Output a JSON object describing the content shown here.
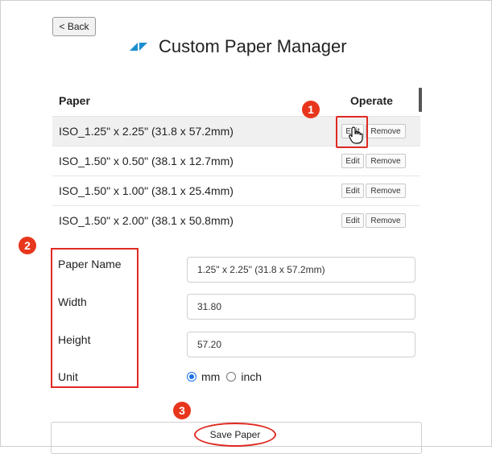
{
  "header": {
    "back_label": "< Back",
    "title": "Custom Paper Manager",
    "logo_icon": "zebra-logo-icon"
  },
  "table": {
    "columns": [
      "Paper",
      "Operate"
    ],
    "rows": [
      {
        "name": "ISO_1.25\" x 2.25\" (31.8 x 57.2mm)",
        "edit": "Edit",
        "remove": "Remove"
      },
      {
        "name": "ISO_1.50\" x 0.50\" (38.1 x 12.7mm)",
        "edit": "Edit",
        "remove": "Remove"
      },
      {
        "name": "ISO_1.50\" x 1.00\" (38.1 x 25.4mm)",
        "edit": "Edit",
        "remove": "Remove"
      },
      {
        "name": "ISO_1.50\" x 2.00\" (38.1 x 50.8mm)",
        "edit": "Edit",
        "remove": "Remove"
      }
    ]
  },
  "form": {
    "paper_name_label": "Paper Name",
    "paper_name_value": "1.25\" x 2.25\" (31.8 x 57.2mm)",
    "width_label": "Width",
    "width_value": "31.80",
    "height_label": "Height",
    "height_value": "57.20",
    "unit_label": "Unit",
    "unit_options": [
      "mm",
      "inch"
    ],
    "unit_selected": "mm"
  },
  "save_label": "Save Paper",
  "annotations": {
    "badge1": "1",
    "badge2": "2",
    "badge3": "3",
    "color": "#e8361c"
  },
  "colors": {
    "accent": "#1a73e8",
    "highlight": "#e02a22",
    "logo": "#1a8fd0"
  }
}
